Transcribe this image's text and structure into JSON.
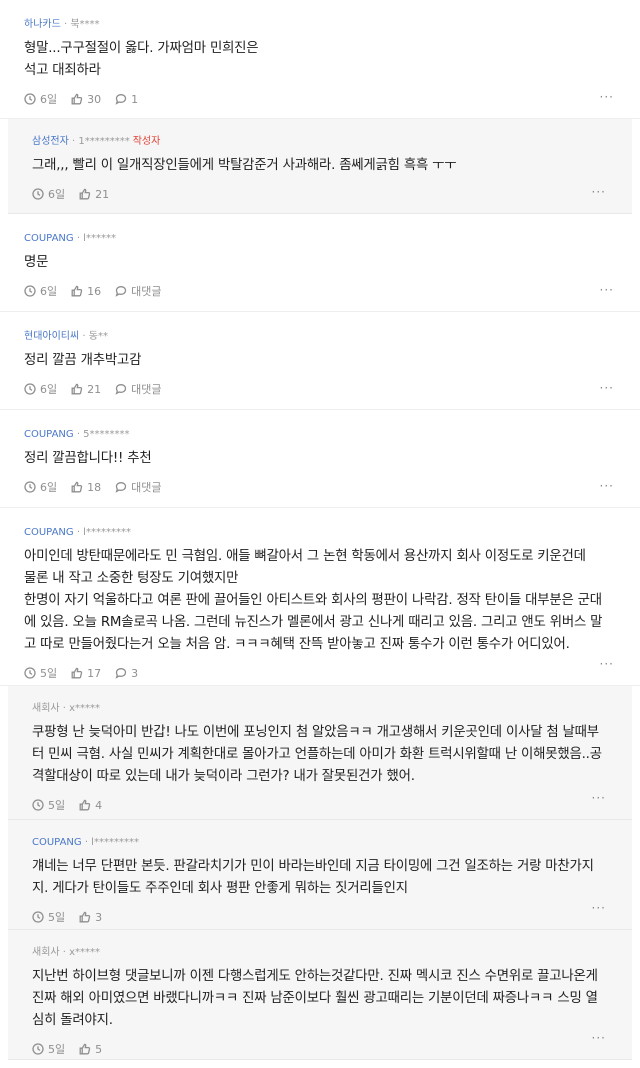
{
  "comments": [
    {
      "type": "top",
      "company": "하나카드",
      "author": "· 북****",
      "badge": "",
      "text": "형말...구구절절이 옳다. 가짜엄마 민희진은\n석고 대죄하라",
      "time": "6일",
      "likes": "30",
      "replies": "1",
      "height": 119
    },
    {
      "type": "reply",
      "company": "삼성전자",
      "author": "· 1*********",
      "badge": "작성자",
      "text": "그래,,, 빨리 이 일개직장인들에게 박탈감준거 사과해라. 좀쎄게긁힘 흑흑 ㅜㅜ",
      "time": "6일",
      "likes": "21",
      "replies": "",
      "height": 95
    },
    {
      "type": "top",
      "company": "COUPANG",
      "author": "· l******",
      "badge": "",
      "text": "명문",
      "time": "6일",
      "likes": "16",
      "replies": "대댓글",
      "height": 98
    },
    {
      "type": "top",
      "company": "현대아이티씨",
      "author": "· 동**",
      "badge": "",
      "text": "정리 깔끔 개추박고감",
      "time": "6일",
      "likes": "21",
      "replies": "대댓글",
      "height": 98
    },
    {
      "type": "top",
      "company": "COUPANG",
      "author": "· 5********",
      "badge": "",
      "text": "정리 깔끔합니다!! 추천",
      "time": "6일",
      "likes": "18",
      "replies": "대댓글",
      "height": 98
    },
    {
      "type": "top",
      "company": "COUPANG",
      "author": "· l*********",
      "badge": "",
      "text": "아미인데 방탄때문에라도 민 극혐임. 애들 뼈갈아서 그 논현 학동에서 용산까지 회사 이정도로 키운건데\n물론 내 작고 소중한 텅장도 기여했지만\n한명이 자기 억울하다고 여론 판에 끌어들인 아티스트와 회사의 평판이 나락감. 정작 탄이들 대부분은 군대\n에 있음. 오늘 RM솔로곡 나옴. 그런데 뉴진스가 멜론에서 광고 신나게 때리고 있음. 그리고 앤도 위버스 말\n고 따로 만들어줬다는거 오늘 처음 암. ㅋㅋㅋ혜택 잔뜩 받아놓고 진짜 통수가 이런 통수가 어디있어.",
      "time": "5일",
      "likes": "17",
      "replies": "3",
      "height": 178
    },
    {
      "type": "reply",
      "company": "",
      "author": "새회사 · x*****",
      "badge": "",
      "text": "쿠팡형 난 늦덕아미 반갑! 나도 이번에 포닝인지 첨 알았음ㅋㅋ 개고생해서 키운곳인데 이사달 첨 날때부\n터 민씨 극혐. 사실 민씨가 계획한대로 몰아가고 언플하는데 아미가 화환 트럭시위할때 난 이해못했음..공\n격할대상이 따로 있는데 내가 늦덕이라 그런가? 내가 잘못된건가 했어.",
      "time": "5일",
      "likes": "4",
      "replies": "",
      "height": 134
    },
    {
      "type": "reply",
      "company": "COUPANG",
      "author": "· l*********",
      "badge": "",
      "text": "걔네는 너무 단편만 본듯. 판갈라치기가 민이 바라는바인데 지금 타이밍에 그건 일조하는 거랑 마찬가지\n지. 게다가 탄이들도 주주인데 회사 평판 안좋게 뭐하는 짓거리들인지",
      "time": "5일",
      "likes": "3",
      "replies": "",
      "height": 110
    },
    {
      "type": "reply",
      "company": "",
      "author": "새회사 · x*****",
      "badge": "",
      "text": "지난번 하이브형 댓글보니까 이젠 다행스럽게도 안하는것같다만. 진짜 멕시코 진스 수면위로 끌고나온게\n진짜 해외 아미였으면 바랬다니까ㅋㅋ 진짜 남준이보다 훨씬 광고때리는 기분이던데 짜증나ㅋㅋ 스밍 열\n심히 돌려야지.",
      "time": "5일",
      "likes": "5",
      "replies": "",
      "height": 130
    }
  ],
  "more_label": "···",
  "colors": {
    "company": "#4a78c8",
    "badge": "#e0453a",
    "reply_bg": "#f6f6f6"
  },
  "icons": {
    "time": "clock-icon",
    "like": "thumbs-up-icon",
    "reply": "speech-bubble-icon",
    "more": "more-options-icon"
  }
}
